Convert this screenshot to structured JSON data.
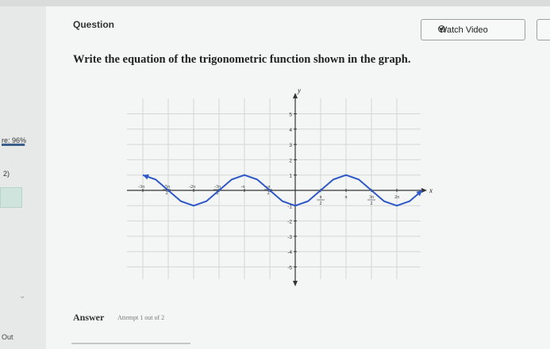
{
  "left_panel": {
    "score_label": "re: 96%",
    "score_progress": 0.96,
    "question_number": "2)",
    "bottom_label": "Out"
  },
  "header": {
    "question_label": "Question",
    "watch_video_label": "Watch Video"
  },
  "prompt": "Write the equation of the trigonometric function shown in the graph.",
  "graph": {
    "x_axis_label": "x",
    "y_axis_label": "y",
    "y_ticks": [
      {
        "v": 5,
        "t": "5"
      },
      {
        "v": 4,
        "t": "4"
      },
      {
        "v": 3,
        "t": "3"
      },
      {
        "v": 2,
        "t": "2"
      },
      {
        "v": 1,
        "t": "1"
      },
      {
        "v": -1,
        "t": "-1"
      },
      {
        "v": -2,
        "t": "-2"
      },
      {
        "v": -3,
        "t": "-3"
      },
      {
        "v": -4,
        "t": "-4"
      },
      {
        "v": -5,
        "t": "-5"
      }
    ],
    "x_ticks": [
      {
        "v": -6,
        "num": "3π",
        "den": ""
      },
      {
        "v": -5,
        "num": "5π",
        "den": "2"
      },
      {
        "v": -4,
        "num": "2π",
        "den": ""
      },
      {
        "v": -3,
        "num": "3π",
        "den": "2"
      },
      {
        "v": -2,
        "num": "π",
        "den": ""
      },
      {
        "v": -1,
        "num": "π",
        "den": "2"
      },
      {
        "v": 1,
        "num": "π",
        "den": "2"
      },
      {
        "v": 2,
        "num": "π",
        "den": ""
      },
      {
        "v": 3,
        "num": "3π",
        "den": "2"
      },
      {
        "v": 4,
        "num": "2π",
        "den": ""
      }
    ]
  },
  "chart_data": {
    "type": "line",
    "title": "",
    "xlabel": "x",
    "ylabel": "y",
    "x_unit": "π/2",
    "xlim": [
      -6.3,
      5.2
    ],
    "ylim": [
      -5.6,
      5.6
    ],
    "grid": true,
    "curve": {
      "x": [
        -6,
        -5.5,
        -5,
        -4.5,
        -4,
        -3.5,
        -3,
        -2.5,
        -2,
        -1.5,
        -1,
        -0.5,
        0,
        0.5,
        1,
        1.5,
        2,
        2.5,
        3,
        3.5,
        4,
        4.5,
        5
      ],
      "y": [
        1,
        0.71,
        0,
        -0.71,
        -1,
        -0.71,
        0,
        0.71,
        1,
        0.71,
        0,
        -0.71,
        -1,
        -0.71,
        0,
        0.71,
        1,
        0.71,
        0,
        -0.71,
        -1,
        -0.71,
        0
      ]
    }
  },
  "answer": {
    "label": "Answer",
    "attempt_text": "Attempt 1 out of 2"
  }
}
